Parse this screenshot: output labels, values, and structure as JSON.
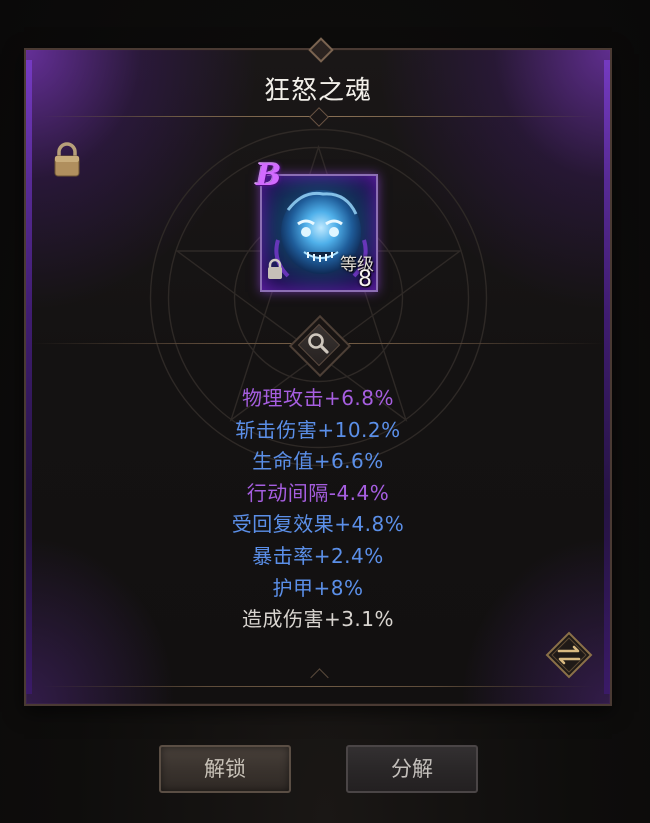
{
  "panel": {
    "title": "狂怒之魂",
    "lock_icon": "padlock-icon"
  },
  "item": {
    "grade": "B",
    "level_label": "等级",
    "level_value": "8",
    "item_lock_icon": "padlock-icon",
    "colors": {
      "grade": "#d26bff",
      "frame_border": "#8c6fb4"
    }
  },
  "magnifier_icon": "magnifier-icon",
  "stats": [
    {
      "text": "物理攻击+6.8%",
      "color": "#a65ee0"
    },
    {
      "text": "斩击伤害+10.2%",
      "color": "#5b8fe8"
    },
    {
      "text": "生命值+6.6%",
      "color": "#5b8fe8"
    },
    {
      "text": "行动间隔-4.4%",
      "color": "#a65ee0"
    },
    {
      "text": "受回复效果+4.8%",
      "color": "#5b8fe8"
    },
    {
      "text": "暴击率+2.4%",
      "color": "#5b8fe8"
    },
    {
      "text": "护甲+8%",
      "color": "#5b8fe8"
    },
    {
      "text": "造成伤害+3.1%",
      "color": "#d8d4cf"
    }
  ],
  "swap_icon": "swap-arrows-icon",
  "buttons": {
    "unlock": "解锁",
    "decompose": "分解"
  }
}
